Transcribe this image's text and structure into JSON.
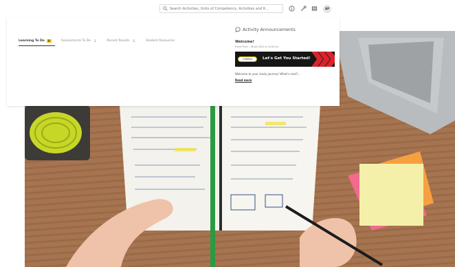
{
  "topbar": {
    "search_placeholder": "Search Activities, Units of Competency, Activities and R...",
    "avatar_initials": "AP"
  },
  "tabs": [
    {
      "label": "Learning To Do",
      "badge": "0",
      "active": true
    },
    {
      "label": "Assessments To Do",
      "badge": "1",
      "active": false
    },
    {
      "label": "Recent Results",
      "badge": "1",
      "active": false
    },
    {
      "label": "Student Resources",
      "badge": "",
      "active": false
    }
  ],
  "announcements": {
    "title": "Activity Announcements",
    "welcome": "Welcome!",
    "meta": "Event Flynn · 06 Jan 2024 at 10:00 am",
    "banner_pill": "O'BEEDI",
    "banner_text": "Let's Get You Started!",
    "body": "Welcome to your study journey! What's next?...",
    "link": "Read more"
  },
  "colors": {
    "accent_yellow": "#f5c400",
    "banner_bg": "#161616",
    "banner_red": "#d8242a"
  }
}
